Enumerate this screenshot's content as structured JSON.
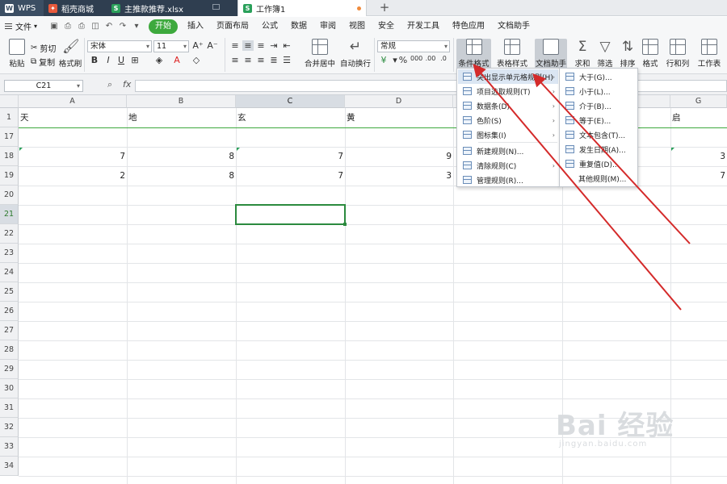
{
  "tabs": {
    "wps": "WPS",
    "store": "稻壳商城",
    "xlsx": "主推款推荐.xlsx",
    "book": "工作簿1",
    "add": "+"
  },
  "menubar": {
    "file": "文件",
    "tabs": [
      "开始",
      "插入",
      "页面布局",
      "公式",
      "数据",
      "审阅",
      "视图",
      "安全",
      "开发工具",
      "特色应用",
      "文档助手"
    ]
  },
  "ribbon": {
    "paste": "粘贴",
    "cut": "剪切",
    "copy": "复制",
    "format_painter": "格式刷",
    "font_name": "宋体",
    "font_size": "11",
    "bold": "B",
    "italic": "I",
    "underline": "U",
    "merge_center": "合并居中",
    "wrap_text": "自动换行",
    "number_format": "常规",
    "cond_format": "条件格式",
    "table_style": "表格样式",
    "doc_assistant": "文档助手",
    "sum": "求和",
    "filter": "筛选",
    "sort": "排序",
    "format": "格式",
    "row_col": "行和列",
    "worksheet": "工作表"
  },
  "formula_bar": {
    "name_box": "C21",
    "fx": "fx",
    "value": ""
  },
  "sheet": {
    "columns": [
      "A",
      "B",
      "C",
      "D",
      "E",
      "F",
      "G"
    ],
    "selected_column": "C",
    "rows": [
      {
        "num": "1",
        "cells": [
          "天",
          "地",
          "玄",
          "黄",
          "",
          "",
          "启"
        ]
      },
      {
        "num": "17",
        "cells": [
          "",
          "",
          "",
          "",
          "",
          "",
          ""
        ]
      },
      {
        "num": "18",
        "cells": [
          "7",
          "8",
          "7",
          "9",
          "",
          "",
          "3"
        ]
      },
      {
        "num": "19",
        "cells": [
          "2",
          "8",
          "7",
          "3",
          "",
          "",
          "7"
        ]
      },
      {
        "num": "20",
        "cells": []
      },
      {
        "num": "21",
        "cells": []
      },
      {
        "num": "22",
        "cells": []
      },
      {
        "num": "23",
        "cells": []
      },
      {
        "num": "24",
        "cells": []
      },
      {
        "num": "25",
        "cells": []
      },
      {
        "num": "26",
        "cells": []
      },
      {
        "num": "27",
        "cells": []
      },
      {
        "num": "28",
        "cells": []
      },
      {
        "num": "29",
        "cells": []
      },
      {
        "num": "30",
        "cells": []
      },
      {
        "num": "31",
        "cells": []
      },
      {
        "num": "32",
        "cells": []
      },
      {
        "num": "33",
        "cells": []
      },
      {
        "num": "34",
        "cells": []
      }
    ],
    "active_cell": "C21",
    "selected_row": "21"
  },
  "cond_format_menu": {
    "items": [
      {
        "label": "突出显示单元格规则(H)",
        "submenu": true,
        "highlighted": true
      },
      {
        "label": "项目选取规则(T)",
        "submenu": true
      },
      {
        "label": "数据条(D)",
        "submenu": true
      },
      {
        "label": "色阶(S)",
        "submenu": true
      },
      {
        "label": "图标集(I)",
        "submenu": true
      },
      {
        "label": "新建规则(N)...",
        "submenu": false
      },
      {
        "label": "清除规则(C)",
        "submenu": true
      },
      {
        "label": "管理规则(R)...",
        "submenu": false
      }
    ]
  },
  "highlight_submenu": {
    "items": [
      "大于(G)...",
      "小于(L)...",
      "介于(B)...",
      "等于(E)...",
      "文本包含(T)...",
      "发生日期(A)...",
      "重复值(D)...",
      "其他规则(M)..."
    ]
  },
  "watermark": {
    "brand": "Bai 经验",
    "url": "jingyan.baidu.com"
  },
  "colors": {
    "accent_green": "#3da93d",
    "selection_green": "#2b8a3e",
    "annotation_red": "#d42a2a",
    "tabbar_dark": "#2f3e50"
  }
}
